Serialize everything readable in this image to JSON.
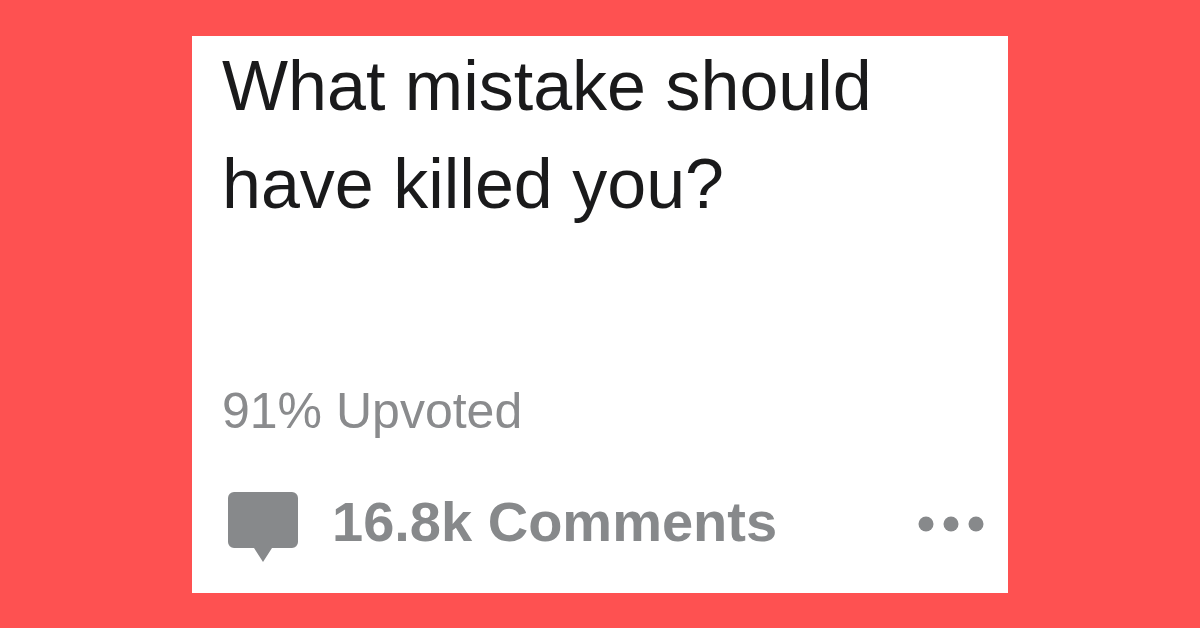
{
  "post": {
    "title": "What mistake should have killed you?",
    "upvote_ratio": "91% Upvoted",
    "comments": "16.8k Comments"
  }
}
